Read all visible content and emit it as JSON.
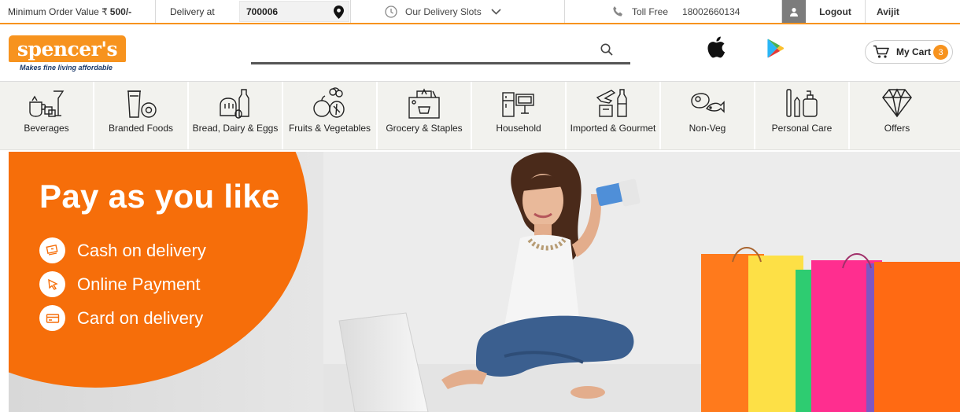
{
  "topbar": {
    "min_order_label": "Minimum Order Value",
    "min_order_symbol": "₹",
    "min_order_value": "500/-",
    "delivery_label": "Delivery at",
    "pincode": "700006",
    "delivery_slots": "Our Delivery Slots",
    "toll_free_label": "Toll Free",
    "toll_free_number": "18002660134",
    "logout": "Logout",
    "user_name": "Avijit"
  },
  "header": {
    "logo_text": "spencer's",
    "logo_tagline": "Makes fine living affordable",
    "search_placeholder": "",
    "cart_label": "My Cart",
    "cart_count": "3"
  },
  "categories": [
    {
      "label": "Beverages",
      "icon": "beverages-icon"
    },
    {
      "label": "Branded Foods",
      "icon": "branded-foods-icon"
    },
    {
      "label": "Bread, Dairy & Eggs",
      "icon": "bread-dairy-icon"
    },
    {
      "label": "Fruits & Vegetables",
      "icon": "fruits-vegetables-icon"
    },
    {
      "label": "Grocery & Staples",
      "icon": "grocery-bag-icon"
    },
    {
      "label": "Household",
      "icon": "household-icon"
    },
    {
      "label": "Imported & Gourmet",
      "icon": "imported-gourmet-icon"
    },
    {
      "label": "Non-Veg",
      "icon": "non-veg-icon"
    },
    {
      "label": "Personal Care",
      "icon": "personal-care-icon"
    },
    {
      "label": "Offers",
      "icon": "diamond-icon"
    }
  ],
  "banner": {
    "title": "Pay as you like",
    "options": [
      "Cash on delivery",
      "Online Payment",
      "Card on delivery"
    ]
  },
  "colors": {
    "brand_orange": "#f7931e",
    "banner_orange": "#f66e0a",
    "logo_navy": "#1b3a6b"
  }
}
